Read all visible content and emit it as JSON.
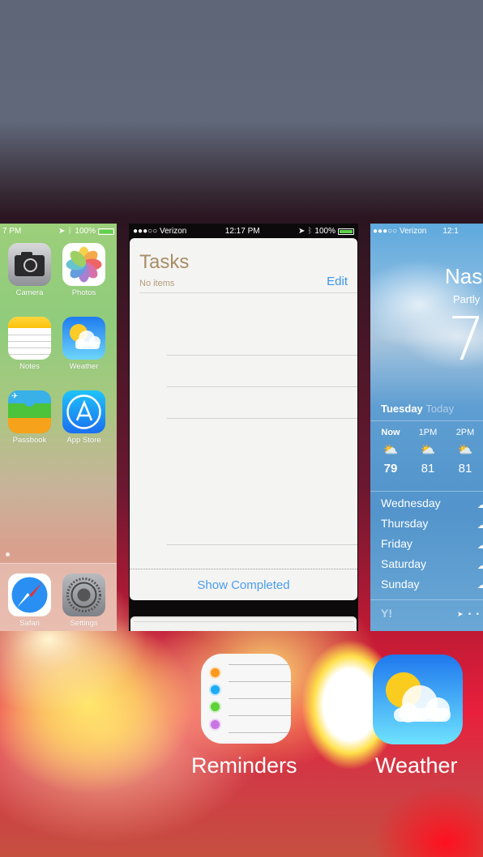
{
  "switcher": {
    "home_card": {
      "status_bar": {
        "time": "7 PM",
        "battery": "100%"
      },
      "apps": [
        {
          "name": "Camera",
          "icon": "camera-icon"
        },
        {
          "name": "Photos",
          "icon": "photos-icon"
        },
        {
          "name": "Notes",
          "icon": "notes-icon"
        },
        {
          "name": "Weather",
          "icon": "weather-icon"
        },
        {
          "name": "Passbook",
          "icon": "passbook-icon"
        },
        {
          "name": "App Store",
          "icon": "app-store-icon"
        }
      ],
      "dock": [
        {
          "name": "Safari",
          "icon": "safari-icon"
        },
        {
          "name": "Settings",
          "icon": "settings-icon"
        }
      ]
    },
    "tasks_card": {
      "status_bar": {
        "carrier": "●●●○○ Verizon",
        "time": "12:17 PM",
        "battery": "100%"
      },
      "title": "Tasks",
      "subtitle": "No items",
      "edit_label": "Edit",
      "show_completed_label": "Show Completed",
      "colors": {
        "title": "#a88d68",
        "link": "#3d95f0"
      }
    },
    "weather_card": {
      "status_bar": {
        "carrier": "●●●○○ Verizon",
        "time": "12:1"
      },
      "city": "Nash",
      "condition": "Partly",
      "temperature": "7",
      "day": "Tuesday",
      "day_suffix": "Today",
      "hourly": [
        {
          "hour": "Now",
          "icon": "partly-sunny-icon",
          "temp": "79"
        },
        {
          "hour": "1PM",
          "icon": "partly-sunny-icon",
          "temp": "81"
        },
        {
          "hour": "2PM",
          "icon": "partly-sunny-icon",
          "temp": "81"
        }
      ],
      "daily": [
        "Wednesday",
        "Thursday",
        "Friday",
        "Saturday",
        "Sunday"
      ],
      "footer_logo": "Y!",
      "page_indicator": "➤ • •"
    },
    "app_labels": [
      {
        "name": "Reminders"
      },
      {
        "name": "Weather"
      }
    ]
  }
}
